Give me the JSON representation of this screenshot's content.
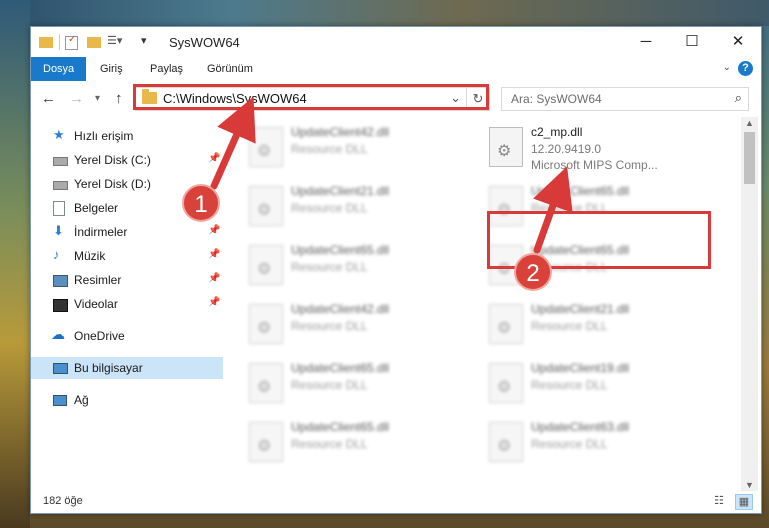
{
  "window": {
    "title": "SysWOW64"
  },
  "ribbon": {
    "tabs": [
      "Dosya",
      "Giriş",
      "Paylaş",
      "Görünüm"
    ]
  },
  "address": {
    "path": "C:\\Windows\\SysWOW64"
  },
  "search": {
    "placeholder": "Ara: SysWOW64"
  },
  "sidebar": {
    "items": [
      {
        "label": "Hızlı erişim",
        "icon": "star-icon"
      },
      {
        "label": "Yerel Disk (C:)",
        "icon": "drive-icon",
        "pinned": true
      },
      {
        "label": "Yerel Disk (D:)",
        "icon": "drive-icon"
      },
      {
        "label": "Belgeler",
        "icon": "document-icon"
      },
      {
        "label": "İndirmeler",
        "icon": "download-icon",
        "pinned": true
      },
      {
        "label": "Müzik",
        "icon": "music-icon",
        "pinned": true
      },
      {
        "label": "Resimler",
        "icon": "pictures-icon",
        "pinned": true
      },
      {
        "label": "Videolar",
        "icon": "video-icon",
        "pinned": true
      },
      {
        "label": "OneDrive",
        "icon": "cloud-icon"
      },
      {
        "label": "Bu bilgisayar",
        "icon": "computer-icon",
        "selected": true
      },
      {
        "label": "Ağ",
        "icon": "network-icon"
      }
    ]
  },
  "files": {
    "highlighted": {
      "name": "c2_mp.dll",
      "version": "12.20.9419.0",
      "description": "Microsoft MIPS Comp..."
    },
    "left_column": [
      {
        "name": "UpdateClient42.dll",
        "type": "Resource DLL"
      },
      {
        "name": "UpdateClient21.dll",
        "type": "Resource DLL"
      },
      {
        "name": "UpdateClient65.dll",
        "type": "Resource DLL"
      },
      {
        "name": "UpdateClient42.dll",
        "type": "Resource DLL"
      },
      {
        "name": "UpdateClient65.dll",
        "type": "Resource DLL"
      },
      {
        "name": "UpdateClient65.dll",
        "type": "Resource DLL"
      }
    ],
    "right_column": [
      {
        "name": "UpdateClient65.dll",
        "type": "Resource DLL"
      },
      {
        "name": "UpdateClient65.dll",
        "type": "Resource DLL"
      },
      {
        "name": "UpdateClient21.dll",
        "type": "Resource DLL"
      },
      {
        "name": "UpdateClient19.dll",
        "type": "Resource DLL"
      },
      {
        "name": "UpdateClient63.dll",
        "type": "Resource DLL"
      }
    ]
  },
  "status": {
    "count": "182 öğe"
  },
  "annotations": {
    "step1": "1",
    "step2": "2",
    "color": "#d83a3a"
  }
}
